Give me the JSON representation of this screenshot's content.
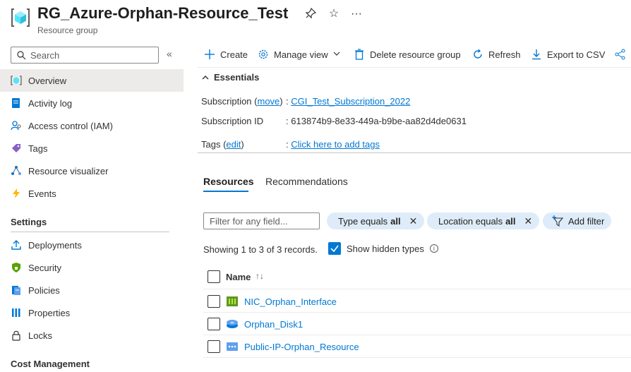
{
  "header": {
    "title": "RG_Azure-Orphan-Resource_Test",
    "subtitle": "Resource group",
    "icons": [
      "resource-group-icon",
      "pin-icon",
      "star-icon",
      "more-icon"
    ]
  },
  "sidebar": {
    "search_placeholder": "Search",
    "collapse_glyph": "«",
    "items": [
      {
        "label": "Overview",
        "icon": "overview-icon",
        "active": true
      },
      {
        "label": "Activity log",
        "icon": "activity-log-icon"
      },
      {
        "label": "Access control (IAM)",
        "icon": "iam-icon"
      },
      {
        "label": "Tags",
        "icon": "tag-icon"
      },
      {
        "label": "Resource visualizer",
        "icon": "visualizer-icon"
      },
      {
        "label": "Events",
        "icon": "events-icon"
      }
    ],
    "settings_header": "Settings",
    "settings_items": [
      {
        "label": "Deployments",
        "icon": "deployments-icon"
      },
      {
        "label": "Security",
        "icon": "security-icon"
      },
      {
        "label": "Policies",
        "icon": "policies-icon"
      },
      {
        "label": "Properties",
        "icon": "properties-icon"
      },
      {
        "label": "Locks",
        "icon": "lock-icon"
      }
    ],
    "cost_header": "Cost Management"
  },
  "toolbar": {
    "create": "Create",
    "manage_view": "Manage view",
    "delete": "Delete resource group",
    "refresh": "Refresh",
    "export": "Export to CSV"
  },
  "essentials": {
    "toggle_label": "Essentials",
    "subscription_key": "Subscription (",
    "subscription_move": "move",
    "subscription_key_end": ")",
    "subscription_value": "CGI_Test_Subscription_2022",
    "subscription_id_key": "Subscription ID",
    "subscription_id_value": "613874b9-8e33-449a-b9be-aa82d4de0631",
    "tags_key": "Tags (",
    "tags_edit": "edit",
    "tags_key_end": ")",
    "tags_value": "Click here to add tags",
    "colon": ":"
  },
  "tabs": {
    "resources": "Resources",
    "recommendations": "Recommendations"
  },
  "filters": {
    "placeholder": "Filter for any field...",
    "type_pill_label": "Type equals",
    "type_pill_value": "all",
    "location_pill_label": "Location equals",
    "location_pill_value": "all",
    "add_filter": "Add filter"
  },
  "records": {
    "text": "Showing 1 to 3 of 3 records.",
    "show_hidden_types": "Show hidden types",
    "show_hidden_checked": true
  },
  "grid": {
    "name_header": "Name",
    "sort_glyph": "↑↓",
    "rows": [
      {
        "name": "NIC_Orphan_Interface",
        "icon": "nic-icon"
      },
      {
        "name": "Orphan_Disk1",
        "icon": "disk-icon"
      },
      {
        "name": "Public-IP-Orphan_Resource",
        "icon": "public-ip-icon"
      }
    ]
  },
  "colors": {
    "accent": "#0078d4",
    "pill_bg": "#deecf9",
    "active_nav_bg": "#edebe9"
  }
}
